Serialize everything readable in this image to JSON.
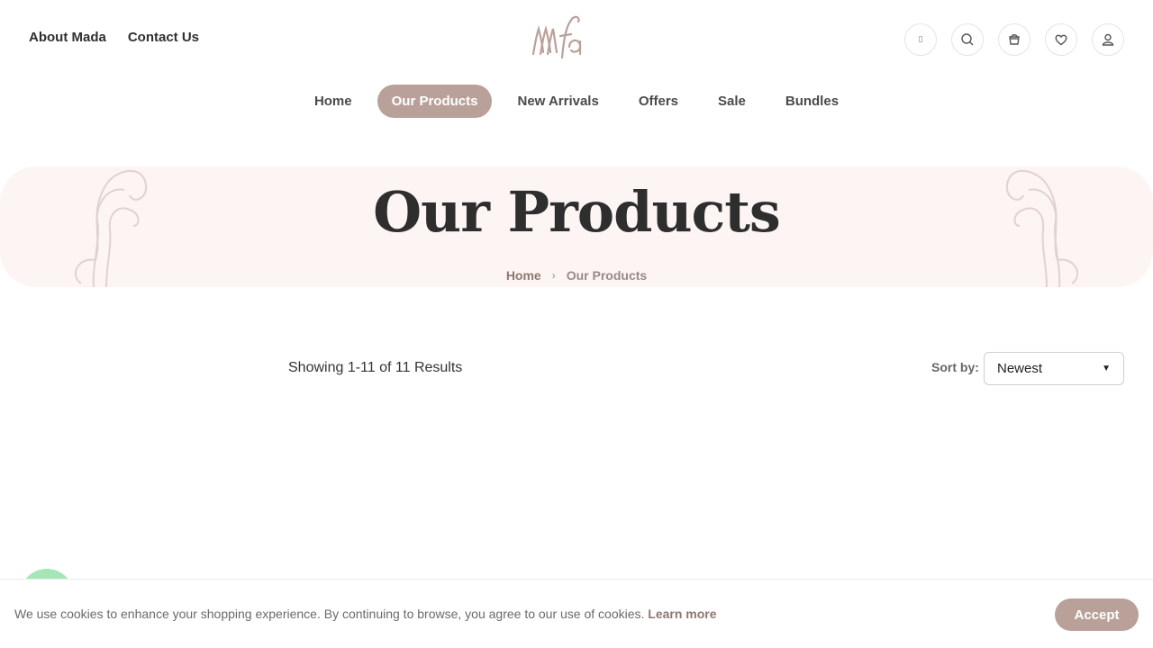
{
  "header": {
    "top_links": [
      "About Mada",
      "Contact Us"
    ],
    "lang_glyph": "▯",
    "icons": [
      "language-icon",
      "search-icon",
      "cart-icon",
      "heart-icon",
      "user-icon"
    ]
  },
  "nav": {
    "items": [
      {
        "label": "Home",
        "active": false
      },
      {
        "label": "Our Products",
        "active": true
      },
      {
        "label": "New Arrivals",
        "active": false
      },
      {
        "label": "Offers",
        "active": false
      },
      {
        "label": "Sale",
        "active": false
      },
      {
        "label": "Bundles",
        "active": false
      }
    ]
  },
  "hero": {
    "title": "Our Products",
    "breadcrumb": {
      "home": "Home",
      "separator": "›",
      "current": "Our Products"
    }
  },
  "toolbar": {
    "results_text": "Showing 1-11 of 11 Results",
    "sort_label": "Sort by:",
    "sort_value": "Newest"
  },
  "cookie": {
    "text": "We use cookies to enhance your shopping experience. By continuing to browse, you agree to our use of cookies.",
    "learn_more": "Learn more",
    "accept_label": "Accept"
  },
  "colors": {
    "accent": "#b9a19a",
    "hero_bg": "#fdf5f4",
    "link": "#8f7770"
  }
}
